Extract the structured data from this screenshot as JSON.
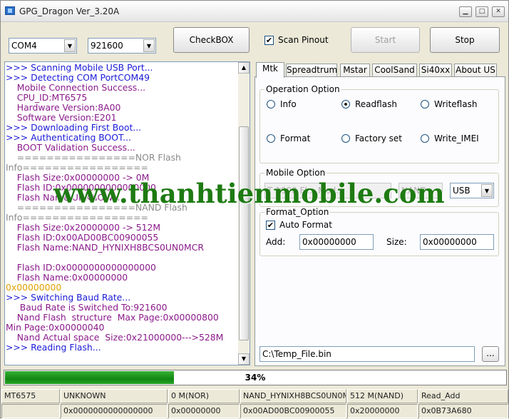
{
  "window": {
    "title": "GPG_Dragon   Ver_3.20A"
  },
  "toolbar": {
    "com_port": "COM4",
    "baud_rate": "921600",
    "checkbox_label": "CheckBOX",
    "scan_pinout_label": "Scan Pinout",
    "start_label": "Start",
    "stop_label": "Stop"
  },
  "log": {
    "lines": [
      {
        "text": ">>> Scanning Mobile USB Port...",
        "color": "#1a1ad6"
      },
      {
        "text": ">>> Detecting COM PortCOM49",
        "color": "#1a1ad6"
      },
      {
        "text": "    Mobile Connection Success...",
        "color": "#8a1a8a"
      },
      {
        "text": "    CPU_ID:MT6575",
        "color": "#8a1a8a"
      },
      {
        "text": "    Hardware Version:8A00",
        "color": "#8a1a8a"
      },
      {
        "text": "    Software Version:E201",
        "color": "#8a1a8a"
      },
      {
        "text": ">>> Downloading First Boot...",
        "color": "#1a1ad6"
      },
      {
        "text": ">>> Authenticating BOOT...",
        "color": "#1a1ad6"
      },
      {
        "text": "    BOOT Validation Success...",
        "color": "#8a1a8a"
      },
      {
        "text": "    ================NOR Flash",
        "color": "#8a8a8a"
      },
      {
        "text": "Info=================",
        "color": "#8a8a8a"
      },
      {
        "text": "    Flash Size:0x00000000 -> 0M",
        "color": "#8a1a8a"
      },
      {
        "text": "    Flash ID:0x0000000000000000",
        "color": "#8a1a8a"
      },
      {
        "text": "    Flash Name:UNKNOWN",
        "color": "#8a1a8a"
      },
      {
        "text": "    ================NAND Flash",
        "color": "#8a8a8a"
      },
      {
        "text": "Info=================",
        "color": "#8a8a8a"
      },
      {
        "text": "    Flash Size:0x20000000 -> 512M",
        "color": "#8a1a8a"
      },
      {
        "text": "    Flash ID:0x00AD00BC00900055",
        "color": "#8a1a8a"
      },
      {
        "text": "    Flash Name:NAND_HYNIXH8BCS0UN0MCR",
        "color": "#8a1a8a"
      },
      {
        "text": "",
        "color": "#8a1a8a"
      },
      {
        "text": "    Flash ID:0x0000000000000000",
        "color": "#8a1a8a"
      },
      {
        "text": "    Flash Name:0x00000000",
        "color": "#8a1a8a"
      },
      {
        "text": "0x00000000",
        "color": "#e0a000"
      },
      {
        "text": ">>> Switching Baud Rate...",
        "color": "#1a1ad6"
      },
      {
        "text": "     Baud Rate is Switched To:921600",
        "color": "#8a1a8a"
      },
      {
        "text": "    Nand Flash  structure  Max Page:0x00000800",
        "color": "#8a1a8a"
      },
      {
        "text": "Min Page:0x00000040",
        "color": "#8a1a8a"
      },
      {
        "text": "    Nand Actual space  Size:0x21000000--->528M",
        "color": "#8a1a8a"
      },
      {
        "text": ">>> Reading Flash...",
        "color": "#1a1ad6"
      }
    ]
  },
  "tabs": [
    "Mtk",
    "Spreadtrum",
    "Mstar",
    "CoolSand",
    "Si40xx",
    "About US"
  ],
  "operation": {
    "label": "Operation Option",
    "options": [
      "Info",
      "Readflash",
      "Writeflash",
      "Format",
      "Factory set",
      "Write_IMEI"
    ],
    "selected": "Readflash"
  },
  "mobile": {
    "label": "Mobile Option",
    "model": "T 1000 Fl... Mod...",
    "storage": "NAND",
    "interface": "USB"
  },
  "format": {
    "label": "Format_Option",
    "auto_label": "Auto Format",
    "add_label": "Add:",
    "add_value": "0x00000000",
    "size_label": "Size:",
    "size_value": "0x00000000"
  },
  "file": {
    "path": "C:\\Temp_File.bin",
    "browse_label": "..."
  },
  "progress": {
    "percent": 34,
    "label": "34%"
  },
  "status_top": [
    "MT6575",
    "UNKNOWN",
    "0 M(NOR)",
    "NAND_HYNIXH8BCS0UN0MCR",
    "512 M(NAND)",
    "Read_Add"
  ],
  "status_bottom": [
    "",
    "0x0000000000000000",
    "0x00000000",
    "0x00AD00BC00900055",
    "0x20000000",
    "0x0B73A680"
  ],
  "watermark": "www.thanhtienmobile.com"
}
